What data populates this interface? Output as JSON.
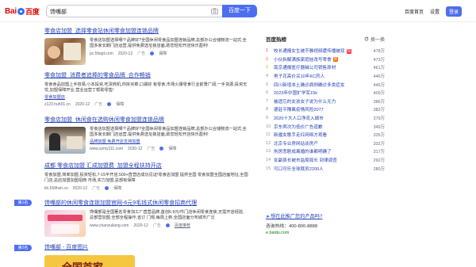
{
  "header": {
    "logo_bai": "Bai",
    "logo_du": "百度",
    "search_value": "馋嘴部",
    "search_button": "百度一下",
    "links": [
      "百度首页",
      "设置"
    ],
    "login": "登录"
  },
  "results": [
    {
      "title": "零食店加盟_选择零食站休闲零食加盟连锁品牌",
      "text": "零食店加盟选择哪个品牌好?全国休闲零食品加盟连锁品牌,总部办公合储物流一站式,全国多家长期门店运营,提供免费选址装店面,助您轻松开店快乐盈利!",
      "url": "pc.5fsqd.com",
      "date": "2020-12",
      "ad": "广告",
      "rating": "保障"
    },
    {
      "title": "零食加盟_消费者追捧的零食品牌_合作畅销",
      "text": "零食食品加盟上手容易,小本投资,吃货商机,你拆买菜,口袋好 有零食,市场火爆零食行业前景广阔,一手货源,投资无忧,加盟保障开业,营业运营丁帮助零售!",
      "sub": "零食加盟店",
      "url": "z123.huh01.cn",
      "date": "2020-12",
      "ad": "广告",
      "rating": "保障"
    },
    {
      "title": "零食店加盟_休闲食在选购休闲零食加盟连锁品牌",
      "text": "零食店加盟选择哪个品牌好?全国休闲零食品加盟连锁品牌,总部办公合储物流一站式,全国多家长期门店运营,提供免费选址装店面,助您轻松开店快乐盈利!",
      "sub": "品牌加盟  免费开店支持加盟",
      "url": "www.szmy111.com",
      "date": "2020-12",
      "ad": "广告",
      "rating": "保障"
    },
    {
      "title": "成都 零食店加盟 汇成加盟费_加盟全程扶持开店",
      "text": "零食加盟,简单加盟,投资轻松,7-15平开店,500+直营店成功见证!零食店加盟 提供全国 零食加盟全国店面地址,全国门店,总店加盟加盟招商 市场,实力加盟,总部有保障",
      "url": "kh.558hsh.cn",
      "date": "2020-12",
      "ad": "广告",
      "rating": "保障"
    },
    {
      "rank": "第1名",
      "title": "馋嘴部的休闲零食连锁加盟官网-6元9毛钱式休闲零食招商代理",
      "text": "馋嘴部是全国著名零食加工厂直营品牌,首创6.9元/件门店休闲零食连锁,无需开店经验,总部营加盟,全部全程操作,省订 门规,每周上新,全国店面分布城市广泛",
      "url": "www.chanzuilang.com",
      "date": "2020-12",
      "ad": "广告",
      "rating": "百度推荐"
    },
    {
      "rank": "第2名",
      "title": "馋嘴部 - 百度图片",
      "thumb_text": "全国首家"
    }
  ],
  "hot": {
    "title": "百度热榜",
    "refresh": "换一换",
    "items": [
      {
        "num": "1",
        "title": "校长通报女生被不雅视频遭传播被双",
        "tag": "热",
        "count": "478万"
      },
      {
        "num": "2",
        "title": "小伙拆解满族家庭娃改写零食",
        "tag": "新",
        "count": "473万"
      },
      {
        "num": "3",
        "title": "南京通报医疗器械公司销售原材",
        "tag": "",
        "count": "461万"
      },
      {
        "num": "4",
        "title": "男子花高价买10年KC药人",
        "tag": "",
        "count": "446万"
      },
      {
        "num": "5",
        "title": "四川新增本土确诊病例确诊多类症女",
        "tag": "",
        "count": "445万"
      },
      {
        "num": "6",
        "title": "2023年中国扩学军15k",
        "tag": "",
        "count": "400万"
      },
      {
        "num": "7",
        "title": "被遗忘的女孩女子说为什么无力",
        "tag": "",
        "count": "386万"
      },
      {
        "num": "8",
        "title": "德驻平隔离疫情风险2077",
        "tag": "",
        "count": "382万"
      },
      {
        "num": "9",
        "title": "2020十大人口净流入城市",
        "tag": "",
        "count": "379万"
      },
      {
        "num": "10",
        "title": "京东两次为低价广告道歉",
        "tag": "",
        "count": "349万"
      },
      {
        "num": "11",
        "title": "新疆女歌手走红网络方观看",
        "tag": "",
        "count": "335万"
      },
      {
        "num": "12",
        "title": "北京专业房网站谈房产",
        "tag": "",
        "count": "332万"
      },
      {
        "num": "13",
        "title": "刑房悲剧成离婚的谁都明确了",
        "tag": "",
        "count": "317万"
      },
      {
        "num": "14",
        "title": "女副县长被市监局局长 到律调查",
        "tag": "",
        "count": "292万"
      },
      {
        "num": "15",
        "title": "可口可乐全球裁员2200人",
        "tag": "",
        "count": "280万"
      }
    ]
  },
  "promo": {
    "title": "想在此推广您的产品吗?",
    "phone": "咨询热线：400-800-8888",
    "url": "e.baidu.com"
  },
  "colors": {
    "accent": "#4e6ef2",
    "link": "#2440b3",
    "highlight": "#f73131"
  }
}
